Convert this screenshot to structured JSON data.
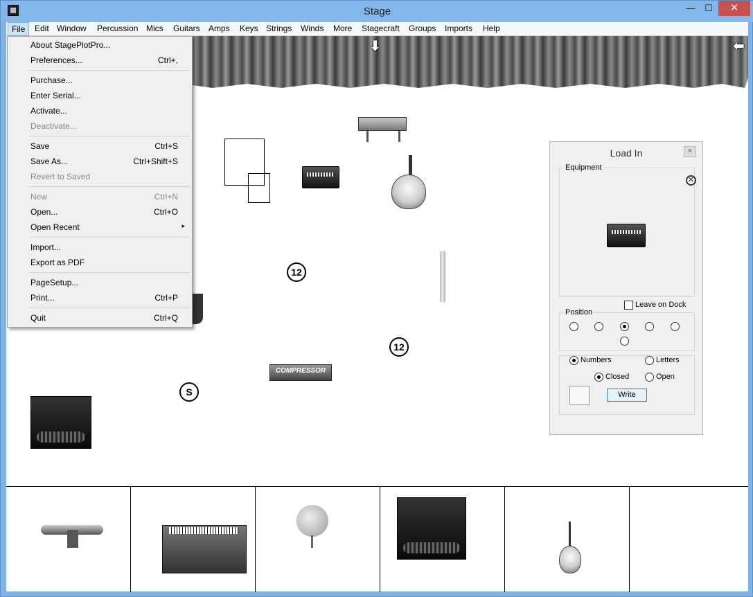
{
  "window": {
    "title": "Stage",
    "minimize": "—",
    "maximize": "☐",
    "close": "✕"
  },
  "menubar": [
    "File",
    "Edit",
    "Window",
    "Percussion",
    "Mics",
    "Guitars",
    "Amps",
    "Keys",
    "Strings",
    "Winds",
    "More",
    "Stagecraft",
    "Groups",
    "Imports",
    "Help"
  ],
  "file_menu": {
    "items": [
      {
        "label": "About StagePlotPro...",
        "shortcut": "",
        "disabled": false
      },
      {
        "label": "Preferences...",
        "shortcut": "Ctrl+,",
        "disabled": false
      },
      {
        "label": "Purchase...",
        "shortcut": "",
        "disabled": false
      },
      {
        "label": "Enter Serial...",
        "shortcut": "",
        "disabled": false
      },
      {
        "label": "Activate...",
        "shortcut": "",
        "disabled": false
      },
      {
        "label": "Deactivate...",
        "shortcut": "",
        "disabled": true
      },
      {
        "label": "Save",
        "shortcut": "Ctrl+S",
        "disabled": false
      },
      {
        "label": "Save As...",
        "shortcut": "Ctrl+Shift+S",
        "disabled": false
      },
      {
        "label": "Revert to Saved",
        "shortcut": "",
        "disabled": true
      },
      {
        "label": "New",
        "shortcut": "Ctrl+N",
        "disabled": true
      },
      {
        "label": "Open...",
        "shortcut": "Ctrl+O",
        "disabled": false
      },
      {
        "label": "Open Recent",
        "shortcut": "",
        "disabled": false,
        "submenu": "▸"
      },
      {
        "label": "Import...",
        "shortcut": "",
        "disabled": false
      },
      {
        "label": "Export as PDF",
        "shortcut": "",
        "disabled": false
      },
      {
        "label": "PageSetup...",
        "shortcut": "",
        "disabled": false
      },
      {
        "label": "Print...",
        "shortcut": "Ctrl+P",
        "disabled": false
      },
      {
        "label": "Quit",
        "shortcut": "Ctrl+Q",
        "disabled": false
      }
    ]
  },
  "stage": {
    "markers": {
      "num1": "12",
      "num2": "12",
      "s_marker": "S"
    },
    "compressor_label": "COMPRESSOR",
    "arrow_down": "⬇",
    "arrow_left": "⬅"
  },
  "load_in": {
    "title": "Load In",
    "close": "×",
    "equipment_label": "Equipment",
    "remove_icon": "✕",
    "leave_on_dock": "Leave on Dock",
    "leave_on_dock_checked": false,
    "position_label": "Position",
    "position_selected": 3,
    "numbers": "Numbers",
    "letters": "Letters",
    "closed": "Closed",
    "open": "Open",
    "numbers_selected": true,
    "closed_selected": true,
    "write": "Write"
  },
  "colors": {
    "accent": "#cce4f7",
    "close": "#c75050",
    "titlebar": "#83b6ea"
  }
}
